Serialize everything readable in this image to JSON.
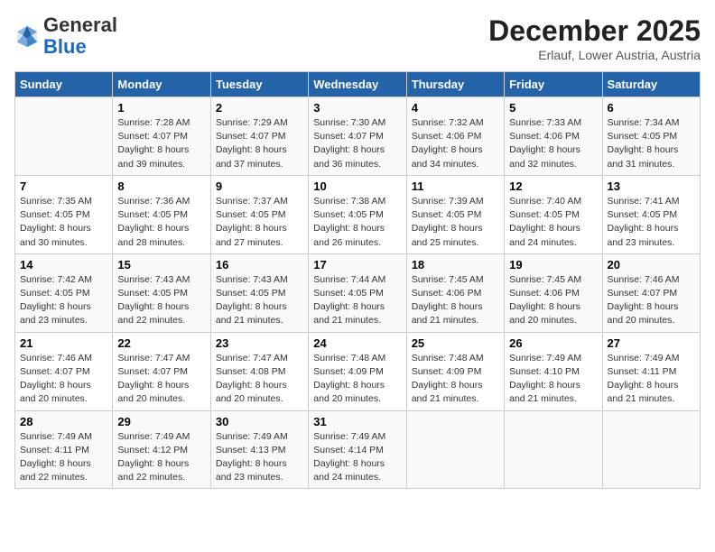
{
  "header": {
    "logo": {
      "line1": "General",
      "line2": "Blue"
    },
    "month": "December 2025",
    "location": "Erlauf, Lower Austria, Austria"
  },
  "days_of_week": [
    "Sunday",
    "Monday",
    "Tuesday",
    "Wednesday",
    "Thursday",
    "Friday",
    "Saturday"
  ],
  "weeks": [
    [
      {
        "day": "",
        "info": ""
      },
      {
        "day": "1",
        "info": "Sunrise: 7:28 AM\nSunset: 4:07 PM\nDaylight: 8 hours\nand 39 minutes."
      },
      {
        "day": "2",
        "info": "Sunrise: 7:29 AM\nSunset: 4:07 PM\nDaylight: 8 hours\nand 37 minutes."
      },
      {
        "day": "3",
        "info": "Sunrise: 7:30 AM\nSunset: 4:07 PM\nDaylight: 8 hours\nand 36 minutes."
      },
      {
        "day": "4",
        "info": "Sunrise: 7:32 AM\nSunset: 4:06 PM\nDaylight: 8 hours\nand 34 minutes."
      },
      {
        "day": "5",
        "info": "Sunrise: 7:33 AM\nSunset: 4:06 PM\nDaylight: 8 hours\nand 32 minutes."
      },
      {
        "day": "6",
        "info": "Sunrise: 7:34 AM\nSunset: 4:05 PM\nDaylight: 8 hours\nand 31 minutes."
      }
    ],
    [
      {
        "day": "7",
        "info": "Sunrise: 7:35 AM\nSunset: 4:05 PM\nDaylight: 8 hours\nand 30 minutes."
      },
      {
        "day": "8",
        "info": "Sunrise: 7:36 AM\nSunset: 4:05 PM\nDaylight: 8 hours\nand 28 minutes."
      },
      {
        "day": "9",
        "info": "Sunrise: 7:37 AM\nSunset: 4:05 PM\nDaylight: 8 hours\nand 27 minutes."
      },
      {
        "day": "10",
        "info": "Sunrise: 7:38 AM\nSunset: 4:05 PM\nDaylight: 8 hours\nand 26 minutes."
      },
      {
        "day": "11",
        "info": "Sunrise: 7:39 AM\nSunset: 4:05 PM\nDaylight: 8 hours\nand 25 minutes."
      },
      {
        "day": "12",
        "info": "Sunrise: 7:40 AM\nSunset: 4:05 PM\nDaylight: 8 hours\nand 24 minutes."
      },
      {
        "day": "13",
        "info": "Sunrise: 7:41 AM\nSunset: 4:05 PM\nDaylight: 8 hours\nand 23 minutes."
      }
    ],
    [
      {
        "day": "14",
        "info": "Sunrise: 7:42 AM\nSunset: 4:05 PM\nDaylight: 8 hours\nand 23 minutes."
      },
      {
        "day": "15",
        "info": "Sunrise: 7:43 AM\nSunset: 4:05 PM\nDaylight: 8 hours\nand 22 minutes."
      },
      {
        "day": "16",
        "info": "Sunrise: 7:43 AM\nSunset: 4:05 PM\nDaylight: 8 hours\nand 21 minutes."
      },
      {
        "day": "17",
        "info": "Sunrise: 7:44 AM\nSunset: 4:05 PM\nDaylight: 8 hours\nand 21 minutes."
      },
      {
        "day": "18",
        "info": "Sunrise: 7:45 AM\nSunset: 4:06 PM\nDaylight: 8 hours\nand 21 minutes."
      },
      {
        "day": "19",
        "info": "Sunrise: 7:45 AM\nSunset: 4:06 PM\nDaylight: 8 hours\nand 20 minutes."
      },
      {
        "day": "20",
        "info": "Sunrise: 7:46 AM\nSunset: 4:07 PM\nDaylight: 8 hours\nand 20 minutes."
      }
    ],
    [
      {
        "day": "21",
        "info": "Sunrise: 7:46 AM\nSunset: 4:07 PM\nDaylight: 8 hours\nand 20 minutes."
      },
      {
        "day": "22",
        "info": "Sunrise: 7:47 AM\nSunset: 4:07 PM\nDaylight: 8 hours\nand 20 minutes."
      },
      {
        "day": "23",
        "info": "Sunrise: 7:47 AM\nSunset: 4:08 PM\nDaylight: 8 hours\nand 20 minutes."
      },
      {
        "day": "24",
        "info": "Sunrise: 7:48 AM\nSunset: 4:09 PM\nDaylight: 8 hours\nand 20 minutes."
      },
      {
        "day": "25",
        "info": "Sunrise: 7:48 AM\nSunset: 4:09 PM\nDaylight: 8 hours\nand 21 minutes."
      },
      {
        "day": "26",
        "info": "Sunrise: 7:49 AM\nSunset: 4:10 PM\nDaylight: 8 hours\nand 21 minutes."
      },
      {
        "day": "27",
        "info": "Sunrise: 7:49 AM\nSunset: 4:11 PM\nDaylight: 8 hours\nand 21 minutes."
      }
    ],
    [
      {
        "day": "28",
        "info": "Sunrise: 7:49 AM\nSunset: 4:11 PM\nDaylight: 8 hours\nand 22 minutes."
      },
      {
        "day": "29",
        "info": "Sunrise: 7:49 AM\nSunset: 4:12 PM\nDaylight: 8 hours\nand 22 minutes."
      },
      {
        "day": "30",
        "info": "Sunrise: 7:49 AM\nSunset: 4:13 PM\nDaylight: 8 hours\nand 23 minutes."
      },
      {
        "day": "31",
        "info": "Sunrise: 7:49 AM\nSunset: 4:14 PM\nDaylight: 8 hours\nand 24 minutes."
      },
      {
        "day": "",
        "info": ""
      },
      {
        "day": "",
        "info": ""
      },
      {
        "day": "",
        "info": ""
      }
    ]
  ]
}
